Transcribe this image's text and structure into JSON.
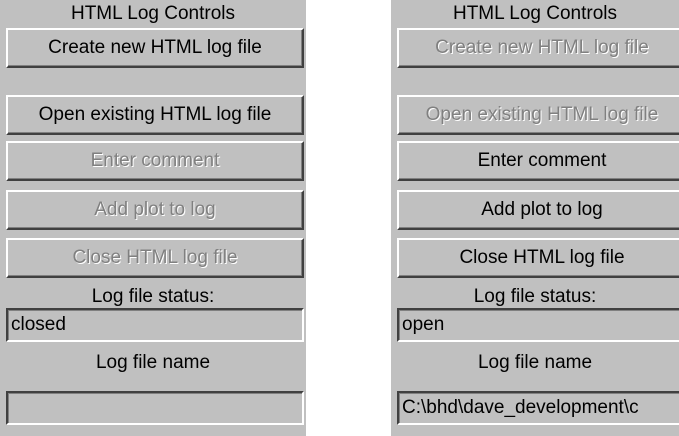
{
  "left_panel": {
    "title": "HTML Log Controls",
    "buttons": {
      "create": "Create new HTML log file",
      "open": "Open existing HTML log file",
      "comment": "Enter comment",
      "add_plot": "Add plot to log",
      "close": "Close HTML log file"
    },
    "status_label": "Log file status:",
    "status_value": "closed",
    "name_label": "Log file name",
    "name_value": ""
  },
  "right_panel": {
    "title": "HTML Log Controls",
    "buttons": {
      "create": "Create new HTML log file",
      "open": "Open existing HTML log file",
      "comment": "Enter comment",
      "add_plot": "Add plot to log",
      "close": "Close HTML log file"
    },
    "status_label": "Log file status:",
    "status_value": "open",
    "name_label": "Log file name",
    "name_value": "C:\\bhd\\dave_development\\c"
  },
  "colors": {
    "panel_bg": "#c0c0c0",
    "disabled_text": "#808080",
    "highlight": "#ffffff",
    "shadow": "#404040"
  }
}
